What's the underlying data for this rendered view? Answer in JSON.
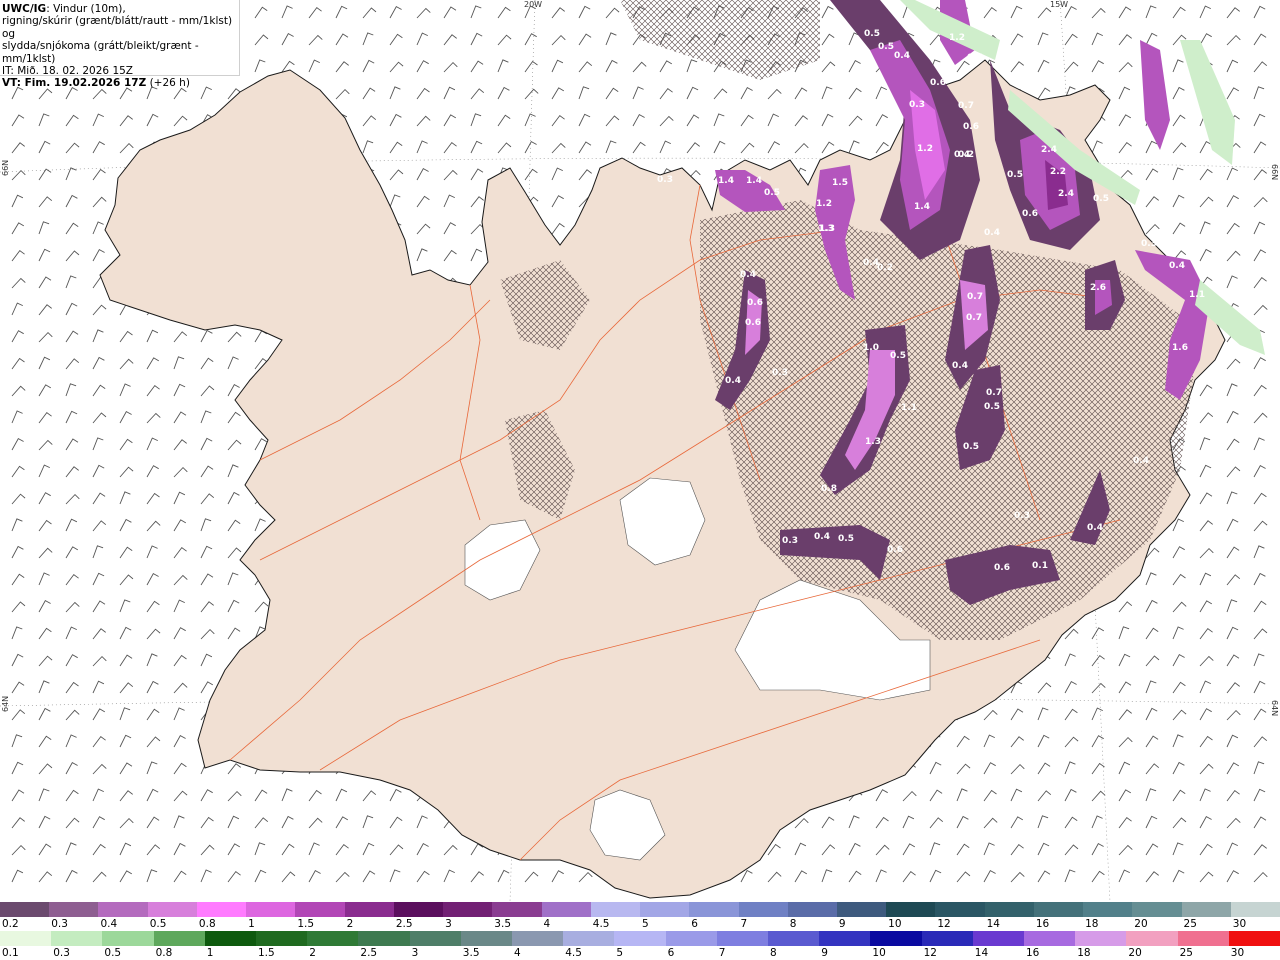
{
  "title": {
    "product": "UWC/IG",
    "description_line1": ": Vindur (10m),",
    "description_line2": "rigning/skúrir (grænt/blátt/rautt - mm/1klst) og",
    "description_line3": "slydda/snjókoma (grátt/bleikt/grænt - mm/1klst)",
    "issue_time": "IT: Mið. 18. 02. 2026 15Z",
    "valid_time": "VT: Fim. 19.02.2026 17Z",
    "lead_time": " (+26 h)"
  },
  "graticule": {
    "top_labels": [
      "20W",
      "15W"
    ],
    "left_labels": [
      "66N",
      "64N"
    ],
    "right_labels": [
      "66N",
      "64N"
    ]
  },
  "precip_labels": [
    "0.5",
    "0.5",
    "0.4",
    "1.2",
    "0.4",
    "0.6",
    "0.7",
    "0.6",
    "0.3",
    "1.2",
    "0.4",
    "0.2",
    "2.4",
    "2.2",
    "2.4",
    "0.5",
    "0.5",
    "0.6",
    "1.4",
    "1.4",
    "0.5",
    "1.3",
    "1.5",
    "1.2",
    "1.3",
    "1.4",
    "0.4",
    "0.2",
    "0.4",
    "0.6",
    "0.6",
    "0.4",
    "0.3",
    "2.6",
    "0.3",
    "0.4",
    "1.6",
    "1.0",
    "0.5",
    "0.7",
    "0.7",
    "0.4",
    "1.1",
    "0.7",
    "0.5",
    "1.3",
    "0.5",
    "0.8",
    "0.4",
    "0.3",
    "0.4",
    "0.3",
    "0.4",
    "0.4",
    "0.5",
    "0.6",
    "0.1",
    "0.6",
    "1.1",
    "0.3"
  ],
  "legend_snow": {
    "labels": [
      "0.2",
      "0.3",
      "0.4",
      "0.5",
      "0.8",
      "1",
      "1.5",
      "2",
      "2.5",
      "3",
      "3.5",
      "4",
      "4.5",
      "5",
      "6",
      "7",
      "8",
      "9",
      "10",
      "12",
      "14",
      "16",
      "18",
      "20",
      "25",
      "30"
    ],
    "colors": [
      "#6b4a6e",
      "#8e5e91",
      "#b46bbe",
      "#d77fdb",
      "#ff7bff",
      "#dd66e0",
      "#b246b6",
      "#8a2c8f",
      "#5b0f5e",
      "#722074",
      "#8a3c91",
      "#a070c8",
      "#b8b8f0",
      "#a2a6e6",
      "#8a95d8",
      "#6f80c4",
      "#5a6ca8",
      "#3e5a7e",
      "#1e4954",
      "#2a5664",
      "#33616b",
      "#44717a",
      "#52808a",
      "#658e93",
      "#8ea6a8",
      "#c6d4d2"
    ]
  },
  "legend_rain": {
    "labels": [
      "0.1",
      "0.3",
      "0.5",
      "0.8",
      "1",
      "1.5",
      "2",
      "2.5",
      "3",
      "3.5",
      "4",
      "4.5",
      "5",
      "6",
      "7",
      "8",
      "9",
      "10",
      "12",
      "14",
      "16",
      "18",
      "20",
      "25",
      "30"
    ],
    "colors": [
      "#e8f8e0",
      "#c4ecc0",
      "#9cd89a",
      "#5ea85c",
      "#0e5a0e",
      "#1f6a1f",
      "#2f7a35",
      "#3e7a50",
      "#4e7e68",
      "#6a8888",
      "#8a98b0",
      "#a8aee0",
      "#b6b6f4",
      "#9a9ae8",
      "#7e7ee0",
      "#5a5ad0",
      "#3434c0",
      "#0a0aa0",
      "#2a2ab8",
      "#6a3ad0",
      "#a76ae0",
      "#d69be8",
      "#f2a0c0",
      "#f07090",
      "#f01010"
    ]
  }
}
